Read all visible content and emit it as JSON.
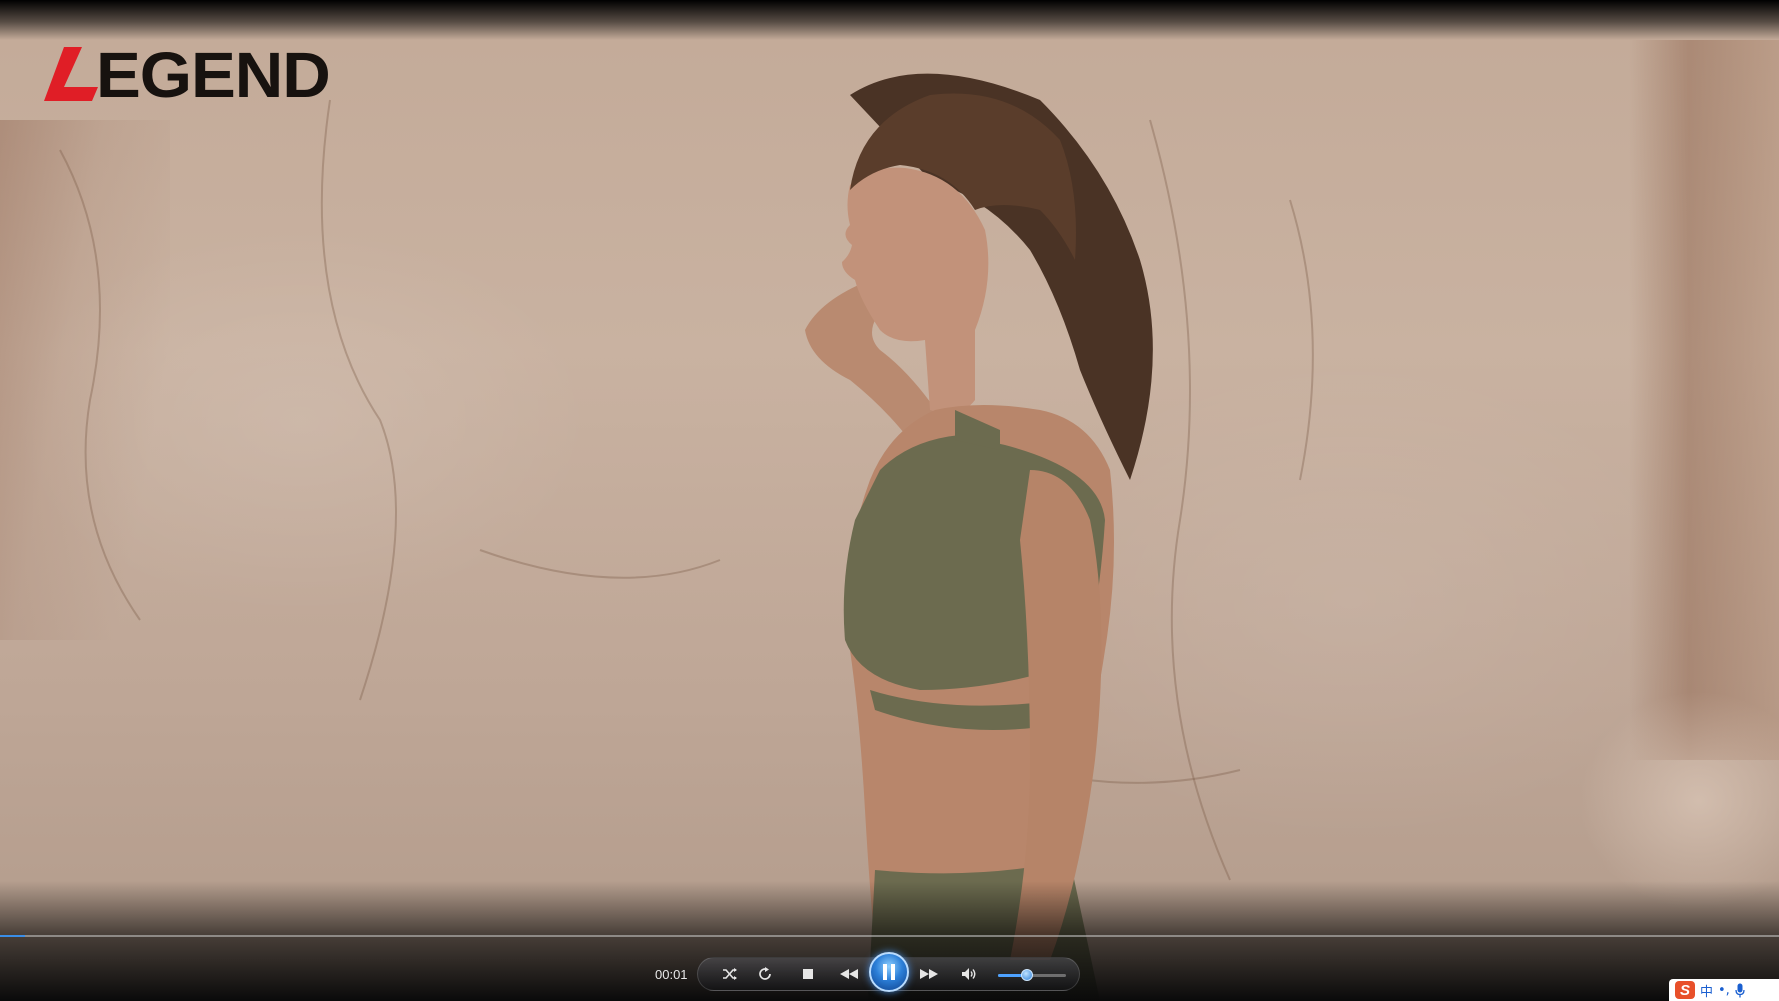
{
  "logo": {
    "text": "EGEND",
    "mark_color": "#e01e26",
    "text_color": "#17120f"
  },
  "player": {
    "time_elapsed": "00:01",
    "progress": 0.014,
    "volume": 0.42,
    "state": "playing",
    "accent_color": "#2c7fd8",
    "controls": [
      {
        "name": "shuffle-icon"
      },
      {
        "name": "repeat-icon"
      },
      {
        "name": "stop-icon"
      },
      {
        "name": "rewind-icon"
      },
      {
        "name": "pause-icon"
      },
      {
        "name": "fast-forward-icon"
      },
      {
        "name": "volume-icon"
      }
    ]
  },
  "ime": {
    "logo": "S",
    "lang": "中",
    "punct": "•,",
    "icons": [
      "sogou-icon",
      "microphone-icon"
    ]
  }
}
